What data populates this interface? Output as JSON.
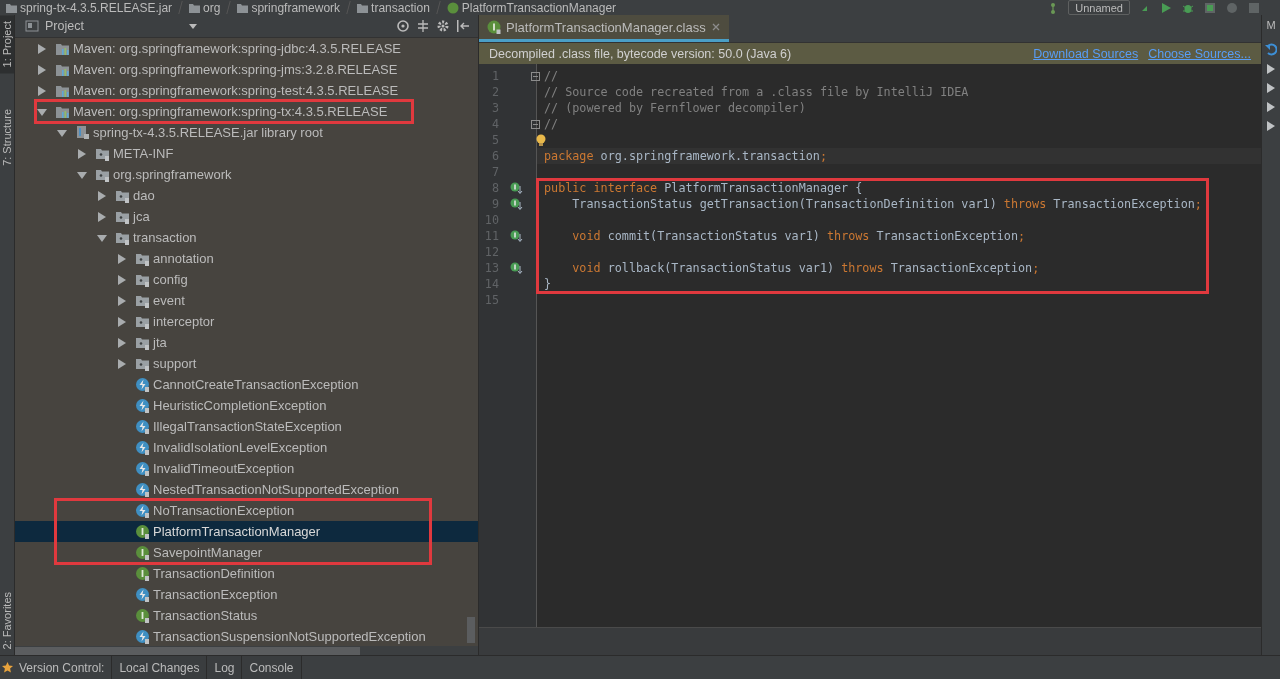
{
  "breadcrumb": [
    "spring-tx-4.3.5.RELEASE.jar",
    "org",
    "springframework",
    "transaction",
    "PlatformTransactionManager"
  ],
  "run_config": {
    "label": "Unnamed"
  },
  "left_tool_strip": [
    {
      "label": "1: Project",
      "selected": true
    },
    {
      "label": "7: Structure",
      "selected": false
    },
    {
      "label": "2: Favorites",
      "selected": false
    }
  ],
  "right_tool_strip": {
    "label": "M"
  },
  "project_panel": {
    "title": "Project",
    "tree": [
      {
        "label": "Maven: org.springframework:spring-jdbc:4.3.5.RELEASE",
        "kind": "library",
        "expanded": false,
        "selected": false
      },
      {
        "label": "Maven: org.springframework:spring-jms:3.2.8.RELEASE",
        "kind": "library",
        "expanded": false,
        "selected": false
      },
      {
        "label": "Maven: org.springframework:spring-test:4.3.5.RELEASE",
        "kind": "library",
        "expanded": false,
        "selected": false
      },
      {
        "label": "Maven: org.springframework:spring-tx:4.3.5.RELEASE",
        "kind": "library",
        "expanded": true,
        "selected": false,
        "annotated": true,
        "children": [
          {
            "label": "spring-tx-4.3.5.RELEASE.jar library root",
            "kind": "jar",
            "expanded": true,
            "selected": false,
            "children": [
              {
                "label": "META-INF",
                "kind": "package",
                "expanded": false,
                "selected": false
              },
              {
                "label": "org.springframework",
                "kind": "package",
                "expanded": true,
                "selected": false,
                "children": [
                  {
                    "label": "dao",
                    "kind": "package",
                    "expanded": false,
                    "selected": false
                  },
                  {
                    "label": "jca",
                    "kind": "package",
                    "expanded": false,
                    "selected": false
                  },
                  {
                    "label": "transaction",
                    "kind": "package",
                    "expanded": true,
                    "selected": false,
                    "children": [
                      {
                        "label": "annotation",
                        "kind": "package",
                        "expanded": false,
                        "selected": false
                      },
                      {
                        "label": "config",
                        "kind": "package",
                        "expanded": false,
                        "selected": false
                      },
                      {
                        "label": "event",
                        "kind": "package",
                        "expanded": false,
                        "selected": false
                      },
                      {
                        "label": "interceptor",
                        "kind": "package",
                        "expanded": false,
                        "selected": false
                      },
                      {
                        "label": "jta",
                        "kind": "package",
                        "expanded": false,
                        "selected": false
                      },
                      {
                        "label": "support",
                        "kind": "package",
                        "expanded": false,
                        "selected": false
                      },
                      {
                        "label": "CannotCreateTransactionException",
                        "kind": "exception",
                        "selected": false
                      },
                      {
                        "label": "HeuristicCompletionException",
                        "kind": "exception",
                        "selected": false
                      },
                      {
                        "label": "IllegalTransactionStateException",
                        "kind": "exception",
                        "selected": false
                      },
                      {
                        "label": "InvalidIsolationLevelException",
                        "kind": "exception",
                        "selected": false
                      },
                      {
                        "label": "InvalidTimeoutException",
                        "kind": "exception",
                        "selected": false
                      },
                      {
                        "label": "NestedTransactionNotSupportedException",
                        "kind": "exception",
                        "selected": false
                      },
                      {
                        "label": "NoTransactionException",
                        "kind": "exception",
                        "selected": false,
                        "annotated": true
                      },
                      {
                        "label": "PlatformTransactionManager",
                        "kind": "interface",
                        "selected": true,
                        "annotated": true
                      },
                      {
                        "label": "SavepointManager",
                        "kind": "interface",
                        "selected": false,
                        "annotated": true
                      },
                      {
                        "label": "TransactionDefinition",
                        "kind": "interface",
                        "selected": false
                      },
                      {
                        "label": "TransactionException",
                        "kind": "exception",
                        "selected": false
                      },
                      {
                        "label": "TransactionStatus",
                        "kind": "interface",
                        "selected": false
                      },
                      {
                        "label": "TransactionSuspensionNotSupportedException",
                        "kind": "exception",
                        "selected": false
                      }
                    ]
                  }
                ]
              }
            ]
          }
        ]
      }
    ]
  },
  "editor": {
    "tabs": [
      {
        "label": "PlatformTransactionManager.class",
        "selected": true
      }
    ],
    "notice": {
      "text": "Decompiled .class file, bytecode version: 50.0 (Java 6)",
      "links": [
        "Download Sources",
        "Choose Sources..."
      ]
    },
    "lines": [
      {
        "number": "1",
        "kind": "fold",
        "tokens": [
          {
            "kind": "comment",
            "text": "//"
          }
        ]
      },
      {
        "number": "2",
        "tokens": [
          {
            "kind": "comment",
            "text": "// Source code recreated from a .class file by IntelliJ IDEA"
          }
        ]
      },
      {
        "number": "3",
        "tokens": [
          {
            "kind": "comment",
            "text": "// (powered by Fernflower decompiler)"
          }
        ]
      },
      {
        "number": "4",
        "kind": "fold",
        "tokens": [
          {
            "kind": "comment",
            "text": "//"
          }
        ]
      },
      {
        "number": "5",
        "kind": "bulb"
      },
      {
        "number": "6",
        "current": true,
        "tokens": [
          {
            "kind": "keyword",
            "text": "package "
          },
          {
            "kind": "plain",
            "text": "org.springframework.transaction"
          },
          {
            "kind": "keyword",
            "text": ";"
          }
        ]
      },
      {
        "number": "7"
      },
      {
        "number": "8",
        "kind": "implemented",
        "annotated": true,
        "tokens": [
          {
            "kind": "keyword",
            "text": "public interface "
          },
          {
            "kind": "plain",
            "text": "PlatformTransactionManager {"
          }
        ]
      },
      {
        "number": "9",
        "kind": "implemented",
        "annotated": true,
        "tokens": [
          {
            "kind": "plain",
            "text": "    TransactionStatus getTransaction(TransactionDefinition var1) "
          },
          {
            "kind": "keyword",
            "text": "throws "
          },
          {
            "kind": "plain",
            "text": "TransactionException"
          },
          {
            "kind": "keyword",
            "text": ";"
          }
        ]
      },
      {
        "number": "10",
        "annotated": true
      },
      {
        "number": "11",
        "kind": "implemented",
        "annotated": true,
        "tokens": [
          {
            "kind": "keyword",
            "text": "    void "
          },
          {
            "kind": "plain",
            "text": "commit(TransactionStatus var1) "
          },
          {
            "kind": "keyword",
            "text": "throws "
          },
          {
            "kind": "plain",
            "text": "TransactionException"
          },
          {
            "kind": "keyword",
            "text": ";"
          }
        ]
      },
      {
        "number": "12",
        "annotated": true
      },
      {
        "number": "13",
        "kind": "implemented",
        "annotated": true,
        "tokens": [
          {
            "kind": "keyword",
            "text": "    void "
          },
          {
            "kind": "plain",
            "text": "rollback(TransactionStatus var1) "
          },
          {
            "kind": "keyword",
            "text": "throws "
          },
          {
            "kind": "plain",
            "text": "TransactionException"
          },
          {
            "kind": "keyword",
            "text": ";"
          }
        ]
      },
      {
        "number": "14",
        "annotated": true,
        "tokens": [
          {
            "kind": "plain",
            "text": "}"
          }
        ]
      },
      {
        "number": "15"
      }
    ]
  },
  "bottom_bar": {
    "label": "Version Control:",
    "tabs": [
      {
        "label": "Local Changes"
      },
      {
        "label": "Log"
      },
      {
        "label": "Console"
      }
    ]
  }
}
